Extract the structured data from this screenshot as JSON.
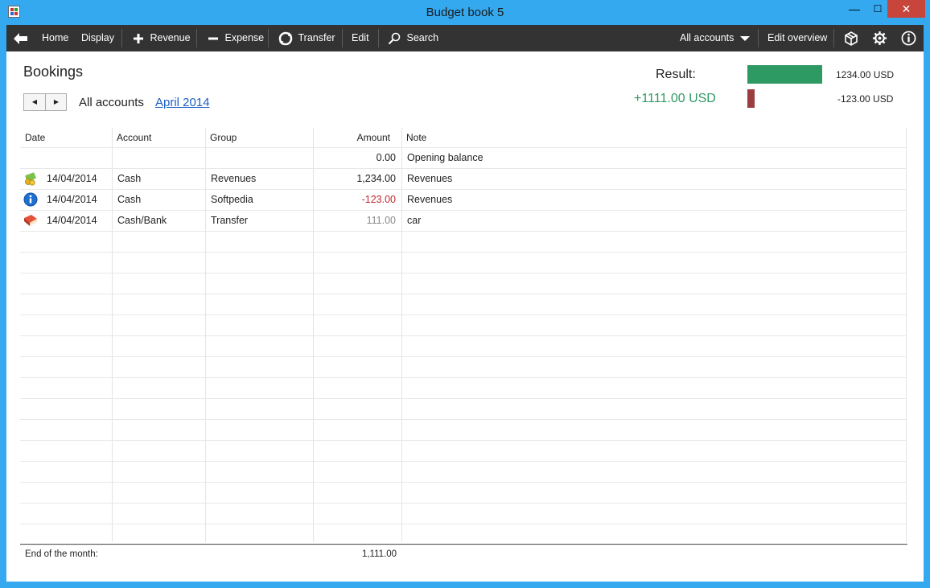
{
  "window": {
    "title": "Budget book 5",
    "minimize": "—",
    "maximize": "☐",
    "close": "✕"
  },
  "toolbar": {
    "home": "Home",
    "display": "Display",
    "revenue": "Revenue",
    "expense": "Expense",
    "transfer": "Transfer",
    "edit": "Edit",
    "search": "Search",
    "all_accounts": "All accounts",
    "edit_overview": "Edit overview"
  },
  "page": {
    "heading": "Bookings",
    "account_filter": "All accounts",
    "month": "April 2014"
  },
  "result": {
    "label": "Result:",
    "value": "+1111.00 USD",
    "revenue_amount": "1234.00 USD",
    "expense_amount": "-123.00 USD",
    "revenue_color": "#2e9a63",
    "expense_color": "#9a3e42"
  },
  "table": {
    "headers": {
      "date": "Date",
      "account": "Account",
      "group": "Group",
      "amount": "Amount",
      "note": "Note"
    },
    "rows": [
      {
        "icon": "",
        "date": "",
        "account": "",
        "group": "",
        "amount": "0.00",
        "note": "Opening balance",
        "amount_color": "#222222"
      },
      {
        "icon": "revenue-money-icon",
        "date": "14/04/2014",
        "account": "Cash",
        "group": "Revenues",
        "amount": "1,234.00",
        "note": "Revenues",
        "amount_color": "#222222"
      },
      {
        "icon": "info-icon",
        "date": "14/04/2014",
        "account": "Cash",
        "group": "Softpedia",
        "amount": "-123.00",
        "note": "Revenues",
        "amount_color": "#c0282d"
      },
      {
        "icon": "book-transfer-icon",
        "date": "14/04/2014",
        "account": "Cash/Bank",
        "group": "Transfer",
        "amount": "111.00",
        "note": "car",
        "amount_color": "#8a8a8a"
      }
    ]
  },
  "footer": {
    "label": "End of the month:",
    "value": "1,111.00"
  }
}
